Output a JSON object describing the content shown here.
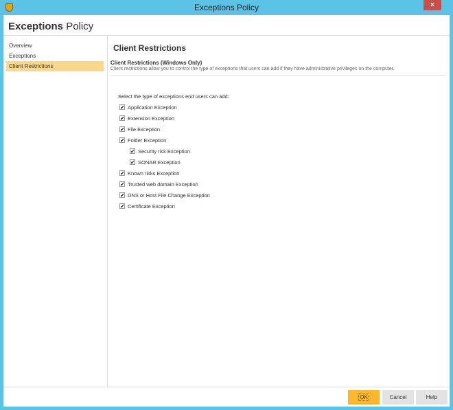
{
  "window": {
    "title": "Exceptions Policy",
    "close_label": "×"
  },
  "header": {
    "title_bold": "Exceptions",
    "title_rest": "Policy"
  },
  "sidebar": {
    "items": [
      {
        "label": "Overview"
      },
      {
        "label": "Exceptions"
      },
      {
        "label": "Client Restrictions",
        "selected": true
      }
    ]
  },
  "content": {
    "heading": "Client Restrictions",
    "section_title": "Client Restrictions (Windows Only)",
    "description": "Client restrictions allow you to control the type of exceptions that users can add if they have administrative privileges on the computer.",
    "prompt": "Select the type of exceptions end users can add:",
    "options": [
      {
        "label": "Application Exception",
        "checked": true
      },
      {
        "label": "Extension Exception",
        "checked": true
      },
      {
        "label": "File Exception",
        "checked": true
      },
      {
        "label": "Folder Exception",
        "checked": true
      },
      {
        "label": "Security risk Exception",
        "checked": true,
        "sub": true
      },
      {
        "label": "SONAR Exception",
        "checked": true,
        "sub": true
      },
      {
        "label": "Known risks Exception",
        "checked": true
      },
      {
        "label": "Trusted web domain Exception",
        "checked": true
      },
      {
        "label": "DNS or Host File Change Exception",
        "checked": true
      },
      {
        "label": "Certificate Exception",
        "checked": true
      }
    ]
  },
  "footer": {
    "ok": "OK",
    "cancel": "Cancel",
    "help": "Help"
  }
}
